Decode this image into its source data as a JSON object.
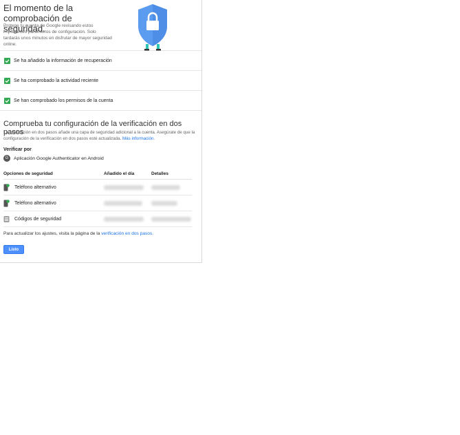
{
  "hero": {
    "title": "El momento de la comprobación de seguridad.",
    "description": "Protege tu cuenta de Google revisando estos importantes parámetros de configuración. Solo tardarás unos minutos en disfrutar de mayor seguridad online."
  },
  "checks": [
    {
      "label": "Se ha añadido la información de recuperación"
    },
    {
      "label": "Se ha comprobado la actividad reciente"
    },
    {
      "label": "Se han comprobado los permisos de la cuenta"
    }
  ],
  "two_step": {
    "title": "Comprueba tu configuración de la verificación en dos pasos",
    "description": "La verificación en dos pasos añade una capa de seguridad adicional a la cuenta. Asegúrate de que la configuración de la verificación en dos pasos esté actualizada.",
    "more_info_link": "Más información.",
    "verify_heading": "Verificar por",
    "verify_method": "Aplicación Google Authenticator en Android",
    "table": {
      "headers": [
        "Opciones de seguridad",
        "Añadido el día",
        "Detalles"
      ],
      "rows": [
        {
          "option": "Teléfono alternativo",
          "icon": "phone-icon"
        },
        {
          "option": "Teléfono alternativo",
          "icon": "phone-icon"
        },
        {
          "option": "Códigos de seguridad",
          "icon": "codes-icon"
        }
      ]
    },
    "footer_prefix": "Para actualizar los ajustes, visita la página de la",
    "footer_link": "verificación en dos pasos.",
    "done_button": "Listo"
  },
  "colors": {
    "check_green": "#34a853",
    "link_blue": "#1a73e8",
    "button_blue": "#4d90fe",
    "shield_blue": "#5b9bf0"
  }
}
